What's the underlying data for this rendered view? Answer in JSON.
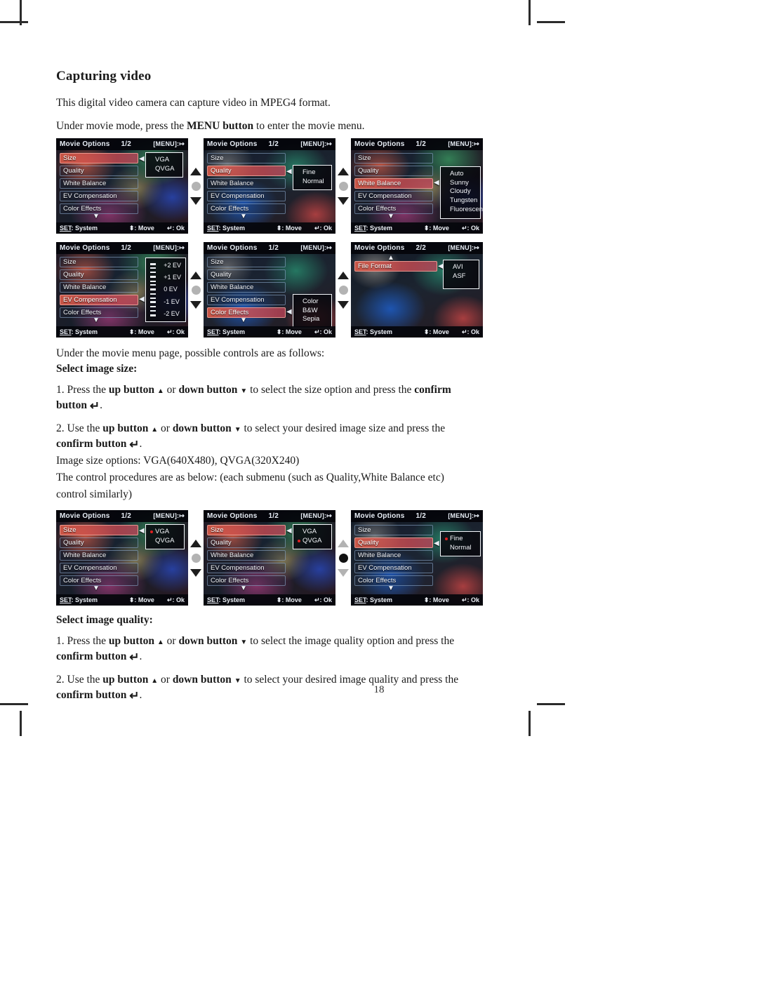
{
  "document": {
    "page_number": "18",
    "title": "Capturing video",
    "intro_line": "This digital video camera can capture video in MPEG4 format.",
    "menu_instruction": {
      "part1": "Under movie mode, press the ",
      "bold": "MENU button",
      "part2": " to enter the movie menu."
    },
    "controls_line": "Under the movie menu page, possible controls are as follows:",
    "section_image_size": "Select image size:",
    "size_step1": {
      "num": "1. Press the ",
      "b1": "up button",
      "mid": " or ",
      "b2": "down button",
      "tail": " to select the size option and press the ",
      "b3": "confirm",
      "cont": "button",
      "period": "."
    },
    "size_step2": {
      "num": "2. Use the ",
      "b1": "up button",
      "mid": " or ",
      "b2": "down button",
      "tail": " to select your desired image size and press the ",
      "cont": "confirm button",
      "period": "."
    },
    "size_options_line": "Image size options: VGA(640X480), QVGA(320X240)",
    "procedure_line_1": "The control procedures are as below: (each submenu (such as Quality,White Balance etc)",
    "procedure_line_2": "control similarly)",
    "section_image_quality": "Select image quality:",
    "quality_step1": {
      "num": "1. Press the ",
      "b1": "up button",
      "mid": " or ",
      "b2": "down button",
      "tail": " to select the image quality option and press the ",
      "cont": "confirm button",
      "period": "."
    },
    "quality_step2": {
      "num": "2. Use the ",
      "b1": "up button",
      "mid": " or ",
      "b2": "down button",
      "tail": " to select your desired image quality and press the ",
      "cont": "confirm button",
      "period": "."
    }
  },
  "lcd_common": {
    "title": "Movie Options",
    "menu_exit": "[MENU]:",
    "footer_set": "SET",
    "footer_set_value": ": System",
    "footer_move": ": Move",
    "footer_ok": ": Ok",
    "menu_items": [
      "Size",
      "Quality",
      "White Balance",
      "EV Compensation",
      "Color Effects"
    ],
    "page_1": "1/2",
    "page_2": "2/2"
  },
  "screens": {
    "row1": [
      {
        "name": "size-menu",
        "page": "1/2",
        "selected": "Size",
        "popup_options": [
          "VGA",
          "QVGA"
        ],
        "marked_option": ""
      },
      {
        "name": "quality-menu",
        "page": "1/2",
        "selected": "Quality",
        "popup_options": [
          "Fine",
          "Normal"
        ],
        "marked_option": ""
      },
      {
        "name": "white-balance-menu",
        "page": "1/2",
        "selected": "White Balance",
        "popup_options": [
          "Auto",
          "Sunny",
          "Cloudy",
          "Tungsten",
          "Fluorescent"
        ],
        "marked_option": ""
      }
    ],
    "row2": [
      {
        "name": "ev-compensation-menu",
        "page": "1/2",
        "selected": "EV Compensation",
        "popup_options": [
          "+2 EV",
          "+1 EV",
          "0 EV",
          "-1 EV",
          "-2 EV"
        ],
        "marked_option": ""
      },
      {
        "name": "color-effects-menu",
        "page": "1/2",
        "selected": "Color Effects",
        "popup_options": [
          "Color",
          "B&W",
          "Sepia"
        ],
        "marked_option": ""
      },
      {
        "name": "file-format-menu",
        "page": "2/2",
        "selected": "File Format",
        "popup_options": [
          "AVI",
          "ASF"
        ],
        "marked_option": ""
      }
    ],
    "row3": [
      {
        "name": "size-vga-selected",
        "page": "1/2",
        "selected": "Size",
        "popup_options": [
          "VGA",
          "QVGA"
        ],
        "marked_option": "VGA"
      },
      {
        "name": "size-qvga-selected",
        "page": "1/2",
        "selected": "Size",
        "popup_options": [
          "VGA",
          "QVGA"
        ],
        "marked_option": "QVGA"
      },
      {
        "name": "quality-fine-selected",
        "page": "1/2",
        "selected": "Quality",
        "popup_options": [
          "Fine",
          "Normal"
        ],
        "marked_option": "Fine"
      }
    ]
  },
  "colors": {
    "selected_highlight": "#d65a48",
    "marker_dot": "#e02020",
    "lcd_text": "#f2f4f8"
  }
}
